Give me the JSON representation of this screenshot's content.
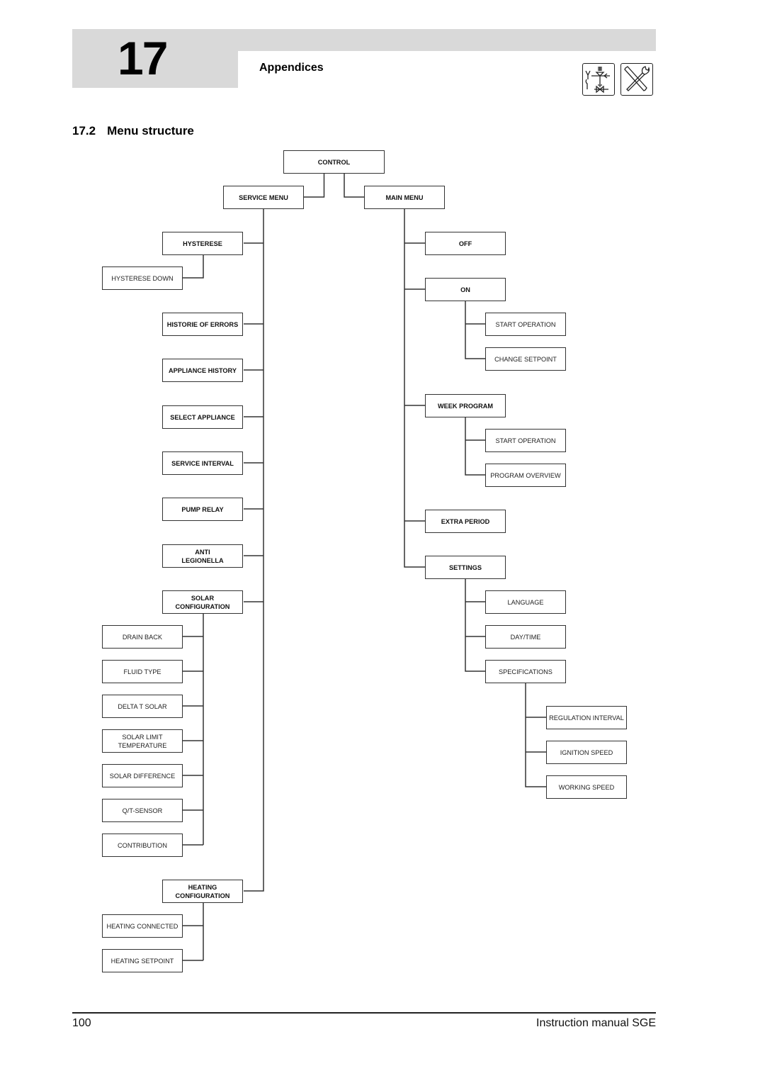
{
  "header": {
    "chapter_number": "17",
    "chapter_title": "Appendices",
    "icons": [
      "installer-valve-icon",
      "service-tools-icon"
    ]
  },
  "section": {
    "number": "17.2",
    "title": "Menu structure"
  },
  "menu": {
    "root": "CONTROL",
    "service_menu": {
      "label": "SERVICE MENU",
      "items": [
        {
          "label": "HYSTERESE",
          "children": [
            "HYSTERESE DOWN"
          ]
        },
        {
          "label": "HISTORIE OF ERRORS",
          "children": []
        },
        {
          "label": "APPLIANCE HISTORY",
          "children": []
        },
        {
          "label": "SELECT APPLIANCE",
          "children": []
        },
        {
          "label": "SERVICE INTERVAL",
          "children": []
        },
        {
          "label": "PUMP RELAY",
          "children": []
        },
        {
          "label": "ANTI\nLEGIONELLA",
          "children": []
        },
        {
          "label": "SOLAR\nCONFIGURATION",
          "children": [
            "DRAIN BACK",
            "FLUID TYPE",
            "DELTA T SOLAR",
            "SOLAR LIMIT\nTEMPERATURE",
            "SOLAR DIFFERENCE",
            "Q/T-SENSOR",
            "CONTRIBUTION"
          ]
        },
        {
          "label": "HEATING\nCONFIGURATION",
          "children": [
            "HEATING CONNECTED",
            "HEATING SETPOINT"
          ]
        }
      ]
    },
    "main_menu": {
      "label": "MAIN MENU",
      "items": [
        {
          "label": "OFF",
          "children": []
        },
        {
          "label": "ON",
          "children": [
            "START OPERATION",
            "CHANGE SETPOINT"
          ]
        },
        {
          "label": "WEEK PROGRAM",
          "children": [
            "START OPERATION",
            "PROGRAM OVERVIEW"
          ]
        },
        {
          "label": "EXTRA PERIOD",
          "children": []
        },
        {
          "label": "SETTINGS",
          "children": [
            "LANGUAGE",
            "DAY/TIME",
            "SPECIFICATIONS"
          ],
          "grandchildren": {
            "SPECIFICATIONS": [
              "REGULATION INTERVAL",
              "IGNITION SPEED",
              "WORKING SPEED"
            ]
          }
        }
      ]
    }
  },
  "footer": {
    "page_number": "100",
    "document_title": "Instruction manual SGE"
  }
}
